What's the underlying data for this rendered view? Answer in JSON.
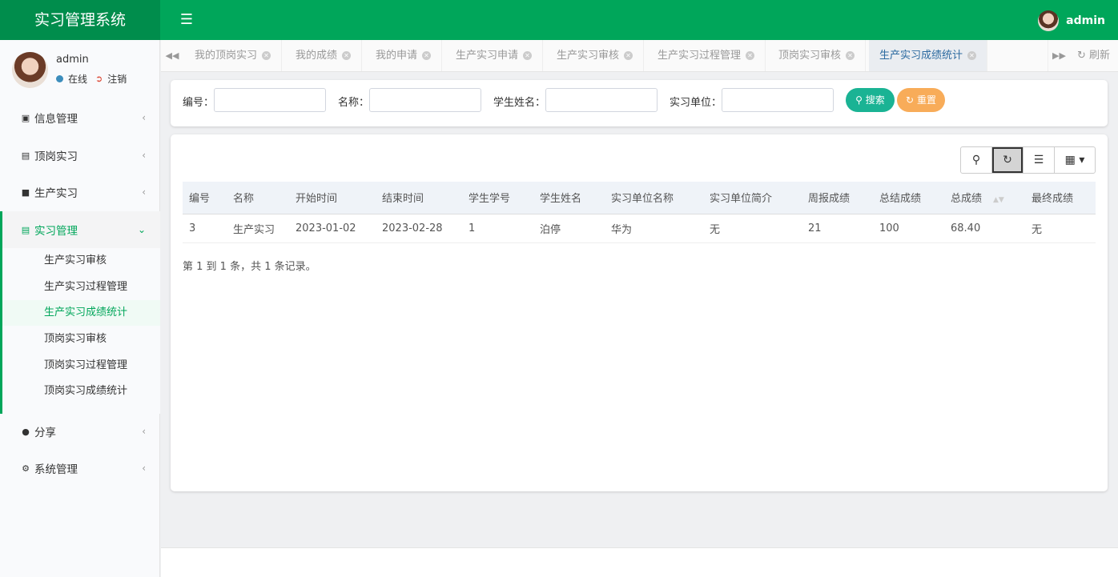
{
  "app": {
    "title": "实习管理系统",
    "menu_toggle_icon": "bars-icon"
  },
  "topbar": {
    "user_name": "admin"
  },
  "sidebar": {
    "user": {
      "name": "admin",
      "status": "在线",
      "logout": "注销"
    },
    "menu": [
      {
        "label": "信息管理",
        "icon": "id-card-icon"
      },
      {
        "label": "顶岗实习",
        "icon": "vcard-icon"
      },
      {
        "label": "生产实习",
        "icon": "user-icon"
      },
      {
        "label": "实习管理",
        "icon": "address-card-icon"
      },
      {
        "label": "分享",
        "icon": "comment-icon"
      },
      {
        "label": "系统管理",
        "icon": "gear-icon"
      }
    ],
    "submenu": [
      {
        "label": "生产实习审核"
      },
      {
        "label": "生产实习过程管理"
      },
      {
        "label": "生产实习成绩统计"
      },
      {
        "label": "顶岗实习审核"
      },
      {
        "label": "顶岗实习过程管理"
      },
      {
        "label": "顶岗实习成绩统计"
      }
    ],
    "active_menu": "实习管理",
    "active_submenu": "生产实习成绩统计"
  },
  "tabs": {
    "items": [
      {
        "label": "我的顶岗实习"
      },
      {
        "label": "我的成绩"
      },
      {
        "label": "我的申请"
      },
      {
        "label": "生产实习申请"
      },
      {
        "label": "生产实习审核"
      },
      {
        "label": "生产实习过程管理"
      },
      {
        "label": "顶岗实习审核"
      },
      {
        "label": "生产实习成绩统计"
      }
    ],
    "active": "生产实习成绩统计",
    "refresh_label": "刷新"
  },
  "search": {
    "fields": [
      {
        "label": "编号：",
        "value": ""
      },
      {
        "label": "名称：",
        "value": ""
      },
      {
        "label": "学生姓名：",
        "value": ""
      },
      {
        "label": "实习单位：",
        "value": ""
      }
    ],
    "search_button": "搜索",
    "reset_button": "重置"
  },
  "table": {
    "toolbar_icons": [
      "search-icon",
      "refresh-icon",
      "list-icon",
      "columns-icon"
    ],
    "columns": [
      "编号",
      "名称",
      "开始时间",
      "结束时间",
      "学生学号",
      "学生姓名",
      "实习单位名称",
      "实习单位简介",
      "周报成绩",
      "总结成绩",
      "总成绩",
      "最终成绩"
    ],
    "rows": [
      [
        "3",
        "生产实习",
        "2023-01-02",
        "2023-02-28",
        "1",
        "泊停",
        "华为",
        "无",
        "21",
        "100",
        "68.40",
        "无"
      ]
    ],
    "pager_text": "第 1 到 1 条，共 1 条记录。"
  },
  "colors": {
    "primary_green": "#00a65a",
    "brand_dark": "#008d4c",
    "search_btn": "#1ab394",
    "reset_btn": "#f8ac59"
  }
}
